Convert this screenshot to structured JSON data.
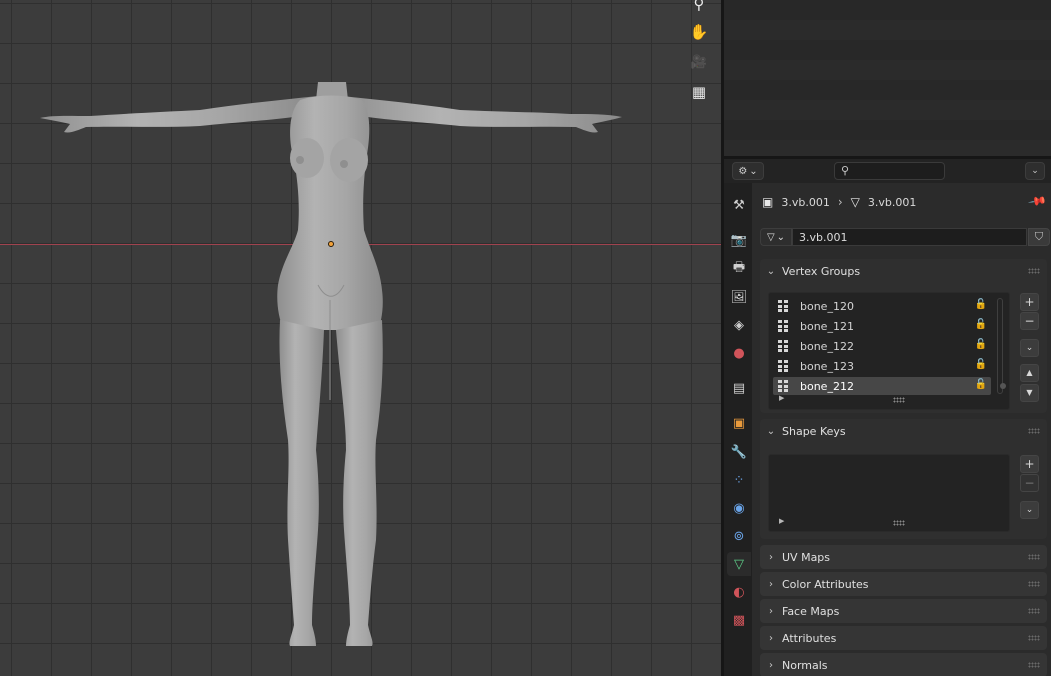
{
  "viewport": {
    "nav_gizmos": [
      {
        "name": "zoom-icon",
        "glyph": "⚲"
      },
      {
        "name": "hand-pan-icon",
        "glyph": "✋"
      },
      {
        "name": "camera-view-icon",
        "glyph": "🎥"
      },
      {
        "name": "grid-perspective-icon",
        "glyph": "▦"
      }
    ],
    "colors": {
      "x_axis": "#a0434f",
      "origin": "#f2a23a",
      "model": "#a9a9a9"
    }
  },
  "properties": {
    "header": {
      "editor_type_icon": "properties-editor-icon",
      "search_placeholder": "",
      "options_icon": "chevron-down-icon"
    },
    "tabs": [
      {
        "name": "tab-tool",
        "icon": "tool-icon",
        "glyph": "⚒"
      },
      {
        "name": "tab-render",
        "icon": "render-icon",
        "glyph": "📷"
      },
      {
        "name": "tab-output",
        "icon": "output-icon",
        "glyph": "🖶"
      },
      {
        "name": "tab-view-layer",
        "icon": "view-layer-icon",
        "glyph": "🖼"
      },
      {
        "name": "tab-scene",
        "icon": "scene-icon",
        "glyph": "◈"
      },
      {
        "name": "tab-world",
        "icon": "world-icon",
        "glyph": "●"
      },
      {
        "name": "tab-collection",
        "icon": "collection-icon",
        "glyph": "▤"
      },
      {
        "name": "tab-object",
        "icon": "object-icon",
        "glyph": "▣"
      },
      {
        "name": "tab-modifiers",
        "icon": "wrench-icon",
        "glyph": "🔧"
      },
      {
        "name": "tab-particles",
        "icon": "particles-icon",
        "glyph": "⁘"
      },
      {
        "name": "tab-physics",
        "icon": "physics-icon",
        "glyph": "◉"
      },
      {
        "name": "tab-constraints",
        "icon": "constraints-icon",
        "glyph": "⊚"
      },
      {
        "name": "tab-data",
        "icon": "mesh-data-icon",
        "glyph": "▽"
      },
      {
        "name": "tab-material",
        "icon": "material-icon",
        "glyph": "◐"
      },
      {
        "name": "tab-texture",
        "icon": "texture-icon",
        "glyph": "▩"
      }
    ],
    "breadcrumb": {
      "object": "3.vb.001",
      "mesh": "3.vb.001"
    },
    "datablock": {
      "name": "3.vb.001"
    },
    "vertex_groups": {
      "title": "Vertex Groups",
      "items": [
        "bone_120",
        "bone_121",
        "bone_122",
        "bone_123",
        "bone_212"
      ],
      "selected_index": 4
    },
    "shape_keys": {
      "title": "Shape Keys"
    },
    "collapsed_panels": [
      "UV Maps",
      "Color Attributes",
      "Face Maps",
      "Attributes",
      "Normals"
    ]
  }
}
